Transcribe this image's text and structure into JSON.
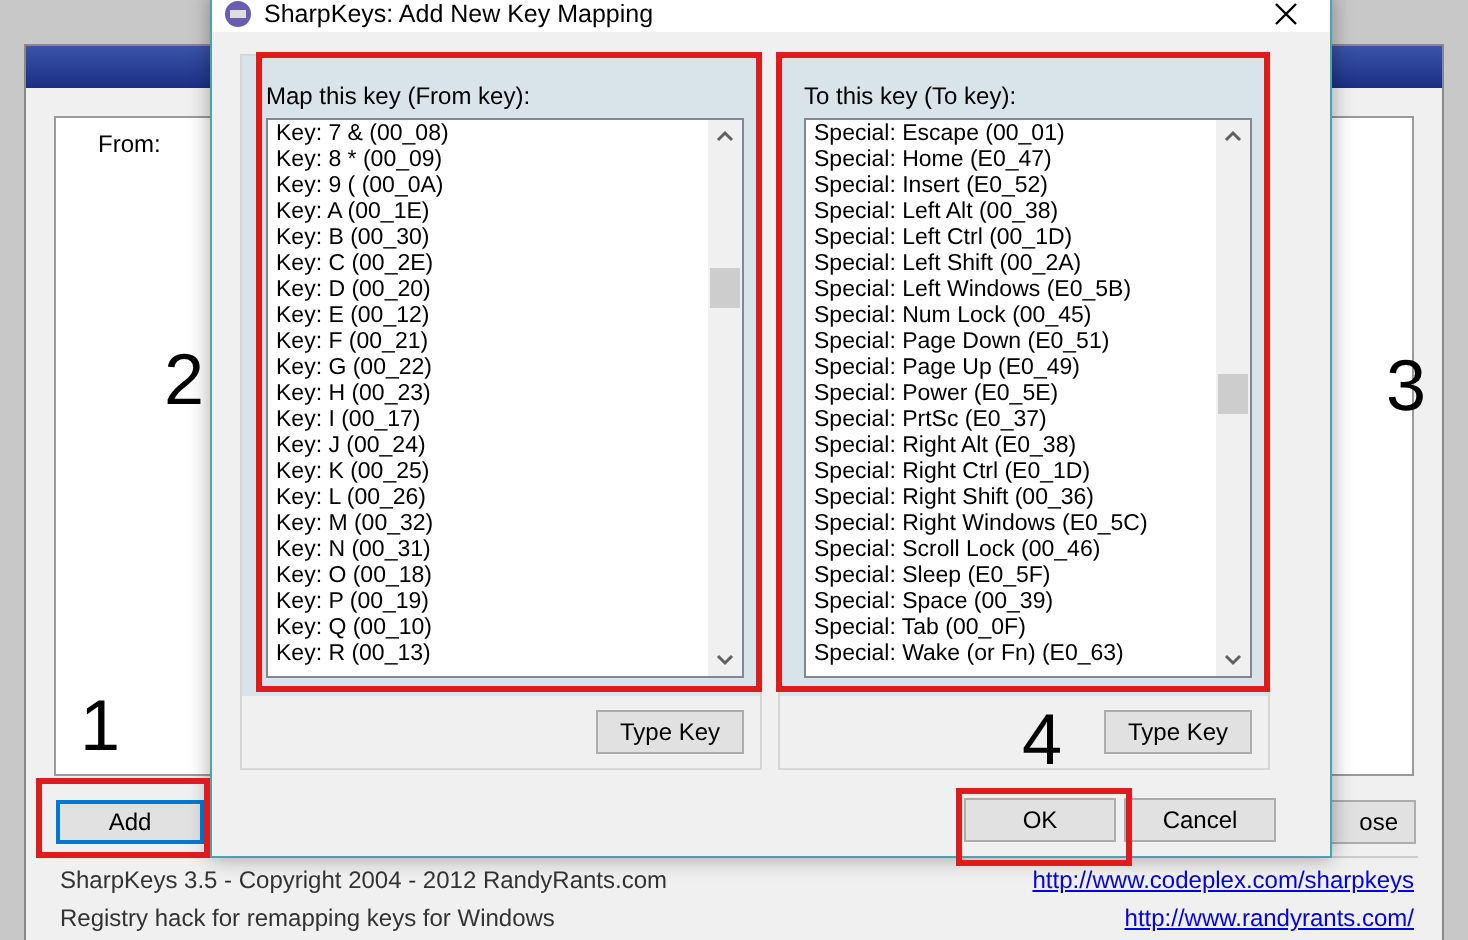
{
  "main_window": {
    "from_label": "From:",
    "buttons": [
      {
        "label": "Add",
        "focused": true
      },
      {
        "label": "ose",
        "focused": false
      }
    ],
    "footer": {
      "copyright": "SharpKeys 3.5 - Copyright 2004 - 2012 RandyRants.com",
      "link": "http://www.codeplex.com/sharpkeys",
      "line_2": "Registry hack for remapping keys for Windows",
      "link_2": "http://www.randyrants.com/"
    }
  },
  "dialog": {
    "title": "SharpKeys: Add New Key Mapping",
    "groups": [
      {
        "label": "Map this key (From key):",
        "button": "Type Key",
        "items": [
          "Key: 7 & (00_08)",
          "Key: 8 * (00_09)",
          "Key: 9 ( (00_0A)",
          "Key: A (00_1E)",
          "Key: B (00_30)",
          "Key: C (00_2E)",
          "Key: D (00_20)",
          "Key: E (00_12)",
          "Key: F (00_21)",
          "Key: G (00_22)",
          "Key: H (00_23)",
          "Key: I (00_17)",
          "Key: J (00_24)",
          "Key: K (00_25)",
          "Key: L (00_26)",
          "Key: M (00_32)",
          "Key: N (00_31)",
          "Key: O (00_18)",
          "Key: P (00_19)",
          "Key: Q (00_10)",
          "Key: R (00_13)"
        ]
      },
      {
        "label": "To this key (To key):",
        "button": "Type Key",
        "items": [
          "Special: Escape (00_01)",
          "Special: Home (E0_47)",
          "Special: Insert (E0_52)",
          "Special: Left Alt (00_38)",
          "Special: Left Ctrl (00_1D)",
          "Special: Left Shift (00_2A)",
          "Special: Left Windows (E0_5B)",
          "Special: Num Lock (00_45)",
          "Special: Page Down (E0_51)",
          "Special: Page Up (E0_49)",
          "Special: Power (E0_5E)",
          "Special: PrtSc (E0_37)",
          "Special: Right Alt (E0_38)",
          "Special: Right Ctrl (E0_1D)",
          "Special: Right Shift (00_36)",
          "Special: Right Windows (E0_5C)",
          "Special: Scroll Lock (00_46)",
          "Special: Sleep (E0_5F)",
          "Special: Space (00_39)",
          "Special: Tab (00_0F)",
          "Special: Wake (or Fn) (E0_63)"
        ]
      }
    ],
    "buttons": [
      "OK",
      "Cancel"
    ]
  },
  "callouts": [
    "1",
    "2",
    "3",
    "4"
  ]
}
